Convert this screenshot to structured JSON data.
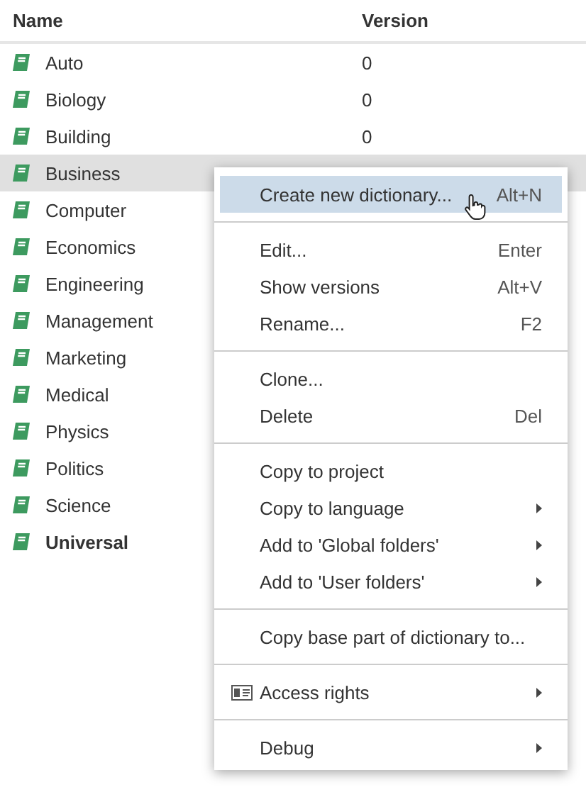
{
  "table": {
    "columns": [
      "Name",
      "Version"
    ],
    "rows": [
      {
        "name": "Auto",
        "version": "0",
        "selected": false,
        "bold": false
      },
      {
        "name": "Biology",
        "version": "0",
        "selected": false,
        "bold": false
      },
      {
        "name": "Building",
        "version": "0",
        "selected": false,
        "bold": false
      },
      {
        "name": "Business",
        "selected": true,
        "bold": false
      },
      {
        "name": "Computer",
        "selected": false,
        "bold": false
      },
      {
        "name": "Economics",
        "selected": false,
        "bold": false
      },
      {
        "name": "Engineering",
        "selected": false,
        "bold": false
      },
      {
        "name": "Management",
        "selected": false,
        "bold": false
      },
      {
        "name": "Marketing",
        "selected": false,
        "bold": false
      },
      {
        "name": "Medical",
        "selected": false,
        "bold": false
      },
      {
        "name": "Physics",
        "selected": false,
        "bold": false
      },
      {
        "name": "Politics",
        "selected": false,
        "bold": false
      },
      {
        "name": "Science",
        "selected": false,
        "bold": false
      },
      {
        "name": "Universal",
        "selected": false,
        "bold": true
      }
    ]
  },
  "context_menu": {
    "items": [
      {
        "kind": "item",
        "label": "Create new dictionary...",
        "shortcut": "Alt+N",
        "selected": true,
        "submenu": false
      },
      {
        "kind": "separator"
      },
      {
        "kind": "item",
        "label": "Edit...",
        "shortcut": "Enter",
        "selected": false,
        "submenu": false
      },
      {
        "kind": "item",
        "label": "Show versions",
        "shortcut": "Alt+V",
        "selected": false,
        "submenu": false
      },
      {
        "kind": "item",
        "label": "Rename...",
        "shortcut": "F2",
        "selected": false,
        "submenu": false
      },
      {
        "kind": "separator"
      },
      {
        "kind": "item",
        "label": "Clone...",
        "selected": false,
        "submenu": false
      },
      {
        "kind": "item",
        "label": "Delete",
        "shortcut": "Del",
        "selected": false,
        "submenu": false
      },
      {
        "kind": "separator"
      },
      {
        "kind": "item",
        "label": "Copy to project",
        "selected": false,
        "submenu": false
      },
      {
        "kind": "item",
        "label": "Copy to language",
        "selected": false,
        "submenu": true
      },
      {
        "kind": "item",
        "label": "Add to 'Global folders'",
        "selected": false,
        "submenu": true
      },
      {
        "kind": "item",
        "label": "Add to 'User folders'",
        "selected": false,
        "submenu": true
      },
      {
        "kind": "separator"
      },
      {
        "kind": "item",
        "label": "Copy base part of dictionary to...",
        "selected": false,
        "submenu": false
      },
      {
        "kind": "separator"
      },
      {
        "kind": "item",
        "label": "Access rights",
        "selected": false,
        "submenu": true,
        "icon": true
      },
      {
        "kind": "separator"
      },
      {
        "kind": "item",
        "label": "Debug",
        "selected": false,
        "submenu": true
      }
    ]
  }
}
